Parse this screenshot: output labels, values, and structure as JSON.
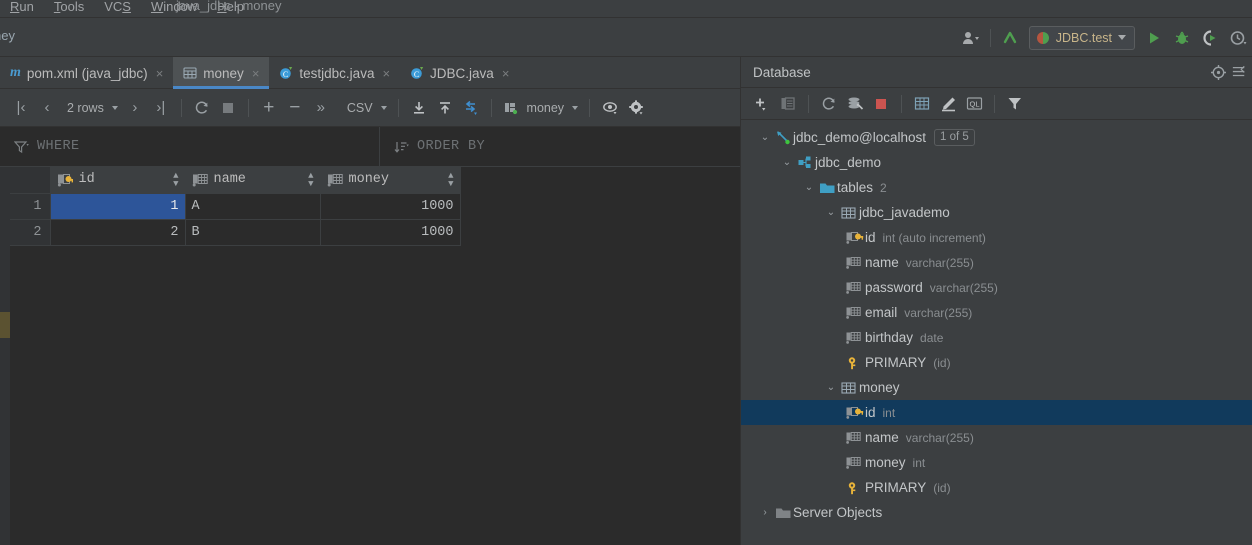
{
  "window": {
    "title": "java_jdbc - money",
    "menu": [
      "Run",
      "Tools",
      "VCS",
      "Window",
      "Help"
    ]
  },
  "navbar": {
    "breadcrumb": "ney",
    "run_config": {
      "label": "JDBC.test",
      "icon": "run-config-icon"
    },
    "icons": [
      "user-settings-icon",
      "update-project-icon",
      "run-icon",
      "debug-icon",
      "run-with-coverage-icon",
      "profiler-icon"
    ]
  },
  "editor_tabs": [
    {
      "label": "pom.xml (java_jdbc)",
      "icon": "maven-icon",
      "active": false,
      "close": "×"
    },
    {
      "label": "money",
      "icon": "table-icon",
      "active": true,
      "close": "×"
    },
    {
      "label": "testjdbc.java",
      "icon": "java-class-icon",
      "active": false,
      "close": "×"
    },
    {
      "label": "JDBC.java",
      "icon": "java-class-icon",
      "active": false,
      "close": "×"
    }
  ],
  "grid_toolbar": {
    "first_page": "|‹",
    "prev_page": "‹",
    "rows_label": "2 rows",
    "next_page": "›",
    "last_page": "›|",
    "reload": "refresh-icon",
    "stop": "stop-icon",
    "add_row": "+",
    "delete_row": "−",
    "more": "»",
    "format_label": "CSV",
    "import_icon": "import-icon",
    "export_icon": "export-icon",
    "transpose_icon": "transpose-icon",
    "datasource_label": "money",
    "view_icon": "eye-icon",
    "settings_icon": "gear-icon"
  },
  "filters": {
    "where_placeholder": "WHERE",
    "where_icon": "filter-icon",
    "order_placeholder": "ORDER BY",
    "order_icon": "sort-icon"
  },
  "result_grid": {
    "columns": [
      {
        "name": "id",
        "icon": "primary-key-column-icon"
      },
      {
        "name": "name",
        "icon": "column-icon"
      },
      {
        "name": "money",
        "icon": "column-icon"
      }
    ],
    "rows": [
      {
        "num": "1",
        "id": "1",
        "name": "A",
        "money": "1000"
      },
      {
        "num": "2",
        "id": "2",
        "name": "B",
        "money": "1000"
      }
    ],
    "selected_cell": {
      "row": 0,
      "column": "id"
    }
  },
  "database_panel": {
    "title": "Database",
    "header_icons": [
      "locate-icon",
      "options-menu-icon"
    ],
    "toolbar_icons": [
      "add-datasource-icon",
      "duplicate-icon",
      "refresh-icon",
      "modify-icon",
      "stop-icon",
      "open-table-editor-icon",
      "edit-icon",
      "jump-to-query-console-icon",
      "filter-icon"
    ],
    "tree": [
      {
        "depth": 0,
        "twist": "⌄",
        "icon": "datasource-icon",
        "label": "jdbc_demo@localhost",
        "meta": "",
        "badge": "1 of 5",
        "selected": false
      },
      {
        "depth": 1,
        "twist": "⌄",
        "icon": "schema-icon",
        "label": "jdbc_demo",
        "meta": "",
        "badge": "",
        "selected": false
      },
      {
        "depth": 2,
        "twist": "⌄",
        "icon": "folder-icon",
        "label": "tables",
        "meta": "2",
        "badge": "",
        "selected": false
      },
      {
        "depth": 3,
        "twist": "⌄",
        "icon": "table-icon",
        "label": "jdbc_javademo",
        "meta": "",
        "badge": "",
        "selected": false
      },
      {
        "depth": 4,
        "twist": "",
        "icon": "primary-key-column-icon",
        "label": "id",
        "meta": "int (auto increment)",
        "badge": "",
        "selected": false
      },
      {
        "depth": 4,
        "twist": "",
        "icon": "column-icon",
        "label": "name",
        "meta": "varchar(255)",
        "badge": "",
        "selected": false
      },
      {
        "depth": 4,
        "twist": "",
        "icon": "column-icon",
        "label": "password",
        "meta": "varchar(255)",
        "badge": "",
        "selected": false
      },
      {
        "depth": 4,
        "twist": "",
        "icon": "column-icon",
        "label": "email",
        "meta": "varchar(255)",
        "badge": "",
        "selected": false
      },
      {
        "depth": 4,
        "twist": "",
        "icon": "column-icon",
        "label": "birthday",
        "meta": "date",
        "badge": "",
        "selected": false
      },
      {
        "depth": 4,
        "twist": "",
        "icon": "key-icon",
        "label": "PRIMARY",
        "meta": "(id)",
        "badge": "",
        "selected": false
      },
      {
        "depth": 3,
        "twist": "⌄",
        "icon": "table-icon",
        "label": "money",
        "meta": "",
        "badge": "",
        "selected": false
      },
      {
        "depth": 4,
        "twist": "",
        "icon": "primary-key-column-icon",
        "label": "id",
        "meta": "int",
        "badge": "",
        "selected": true
      },
      {
        "depth": 4,
        "twist": "",
        "icon": "column-icon",
        "label": "name",
        "meta": "varchar(255)",
        "badge": "",
        "selected": false
      },
      {
        "depth": 4,
        "twist": "",
        "icon": "column-icon",
        "label": "money",
        "meta": "int",
        "badge": "",
        "selected": false
      },
      {
        "depth": 4,
        "twist": "",
        "icon": "key-icon",
        "label": "PRIMARY",
        "meta": "(id)",
        "badge": "",
        "selected": false
      },
      {
        "depth": 1,
        "twist": "›",
        "icon": "folder-icon",
        "label": "Server Objects",
        "meta": "",
        "badge": "",
        "selected": false
      }
    ]
  },
  "colors": {
    "bg": "#3c3f41",
    "editor_bg": "#2b2b2b",
    "accent_blue": "#4a88c7",
    "selection_blue": "#2d5599",
    "tree_selection": "#113a5c",
    "key_yellow": "#e8b33a",
    "teal": "#4c9aad",
    "green": "#4f9e4f",
    "red": "#cc5450"
  }
}
